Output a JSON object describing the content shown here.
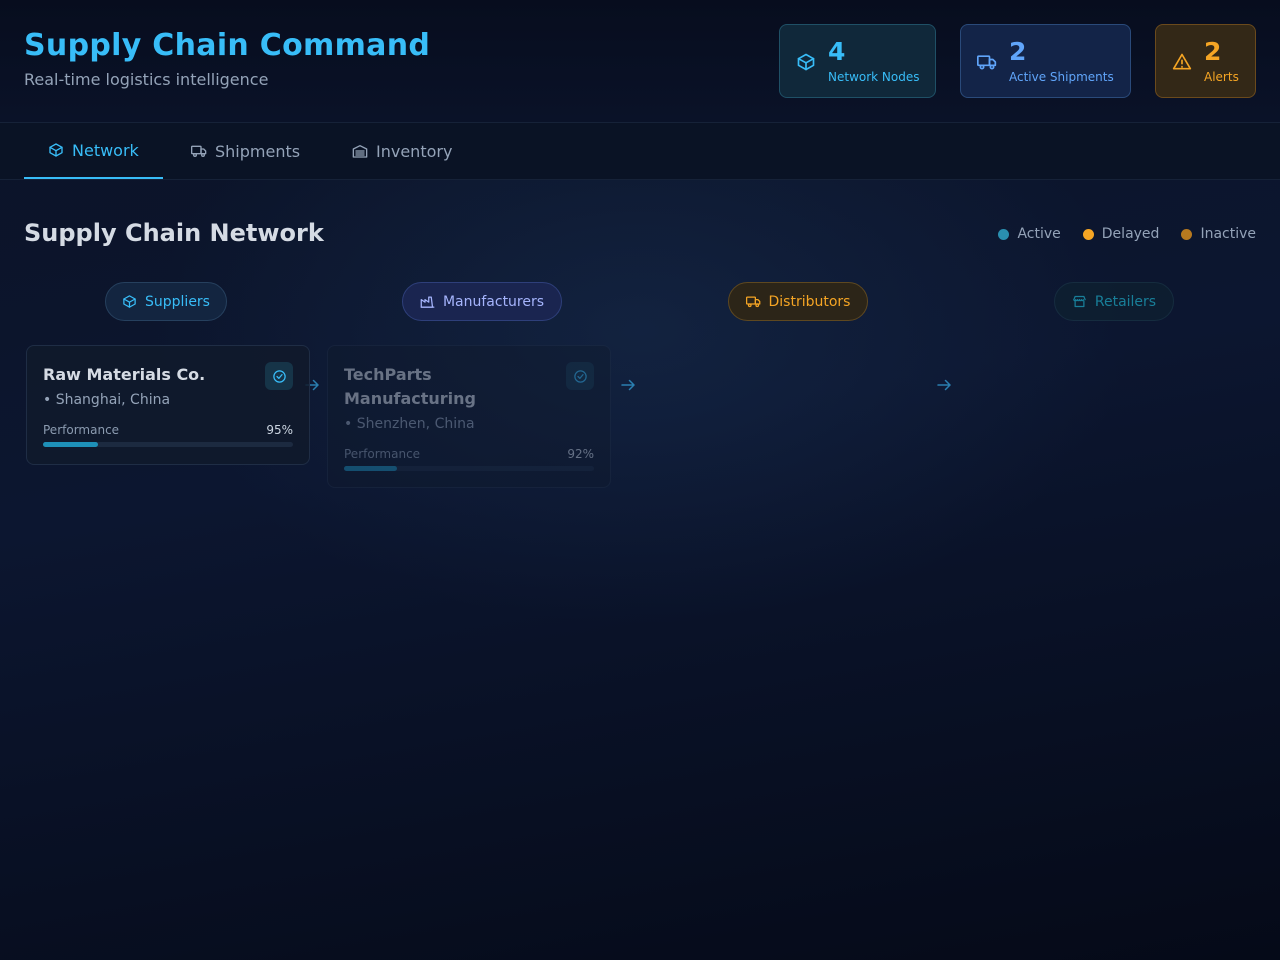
{
  "header": {
    "title": "Supply Chain Command",
    "subtitle": "Real-time logistics intelligence",
    "stats": [
      {
        "icon": "package-icon",
        "value": "4",
        "label": "Network Nodes"
      },
      {
        "icon": "truck-icon",
        "value": "2",
        "label": "Active Shipments"
      },
      {
        "icon": "alert-triangle-icon",
        "value": "2",
        "label": "Alerts"
      }
    ]
  },
  "tabs": [
    {
      "icon": "package-icon",
      "label": "Network",
      "active": true
    },
    {
      "icon": "truck-icon",
      "label": "Shipments",
      "active": false
    },
    {
      "icon": "warehouse-icon",
      "label": "Inventory",
      "active": false
    }
  ],
  "main": {
    "title": "Supply Chain Network",
    "legend": [
      {
        "label": "Active",
        "color": "#2a8fb0"
      },
      {
        "label": "Delayed",
        "color": "#f5a524"
      },
      {
        "label": "Inactive",
        "color": "#b7791f"
      }
    ],
    "stages": [
      {
        "icon": "package-icon",
        "label": "Suppliers",
        "color": "#38bdf8"
      },
      {
        "icon": "factory-icon",
        "label": "Manufacturers",
        "color": "#a5b4fc"
      },
      {
        "icon": "truck-icon",
        "label": "Distributors",
        "color": "#f5a524"
      },
      {
        "icon": "store-icon",
        "label": "Retailers",
        "color": "#22d3ee"
      }
    ],
    "nodes": [
      {
        "name": "Raw Materials Co.",
        "location": "Shanghai, China",
        "performance_label": "Performance",
        "performance_text": "95%",
        "performance": 0.95
      },
      {
        "name": "TechParts Manufacturing",
        "location": "Shenzhen, China",
        "performance_label": "Performance",
        "performance_text": "92%",
        "performance": 0.92
      }
    ]
  }
}
